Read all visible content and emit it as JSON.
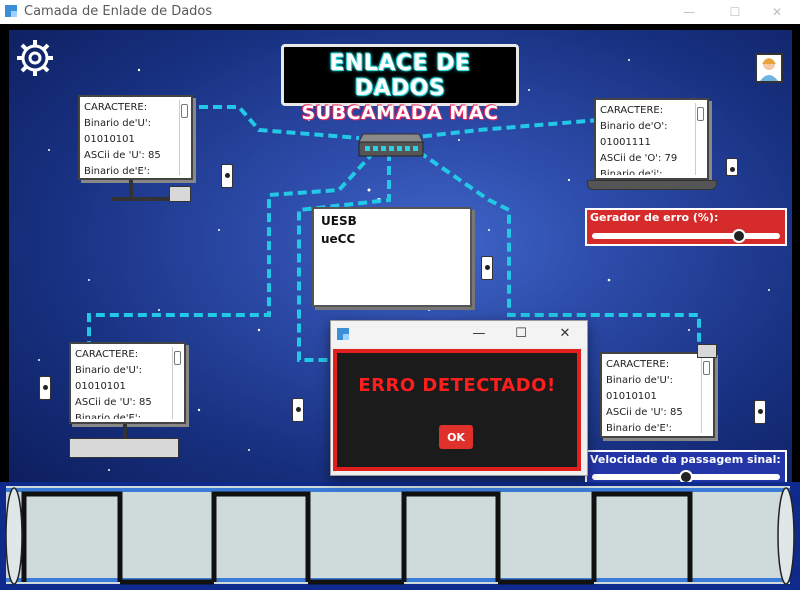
{
  "window": {
    "title": "Camada de Enlade de Dados",
    "minimize": "—",
    "maximize": "☐",
    "close": "✕"
  },
  "banner": {
    "line1": "ENLACE DE DADOS",
    "line2": "SUBCAMADA MAC"
  },
  "computers": {
    "top_left": [
      "CARACTERE:",
      "Binario de'U':",
      "01010101",
      "ASCii de 'U': 85",
      "Binario de'E':"
    ],
    "top_right": [
      "CARACTERE:",
      "Binario de'O':",
      "01001111",
      "ASCii de 'O': 79",
      "Binario de'i':"
    ],
    "bottom_left": [
      "CARACTERE:",
      "Binario de'U':",
      "01010101",
      "ASCii de 'U': 85",
      "Binario de'E':"
    ],
    "bottom_right": [
      "CARACTERE:",
      "Binario de'U':",
      "01010101",
      "ASCii de 'U': 85",
      "Binario de'E':"
    ]
  },
  "central_display": {
    "lines": [
      "UESB",
      "ueCC"
    ]
  },
  "error_slider": {
    "label": "Gerador de erro (%):",
    "value_fraction": 0.78
  },
  "speed_slider": {
    "label": "Velocidade da passagem sinal:",
    "value_fraction": 0.5
  },
  "dialog": {
    "minimize": "—",
    "maximize": "☐",
    "close": "✕",
    "message": "ERRO DETECTADO!",
    "ok_label": "OK"
  },
  "colors": {
    "cable": "#22c8e6",
    "error_panel": "#d52b2b",
    "speed_panel": "#2435a8",
    "error_text": "#ff1e1e",
    "ok_button": "#e0302c"
  },
  "icons": {
    "settings": "gear-icon",
    "user": "user-avatar-icon",
    "switch": "network-switch-icon"
  }
}
